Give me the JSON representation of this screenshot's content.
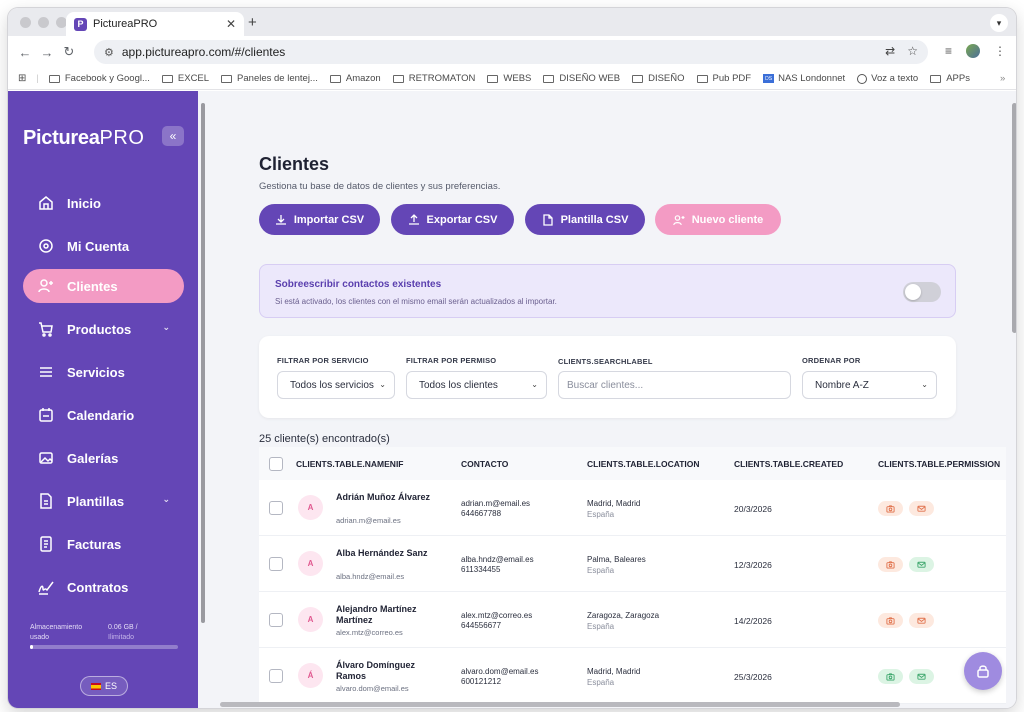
{
  "browser": {
    "tab_title": "PictureaPRO",
    "favicon_letter": "P",
    "url": "app.pictureapro.com/#/clientes",
    "bookmarks": [
      "Facebook y Googl...",
      "EXCEL",
      "Paneles de lentej...",
      "Amazon",
      "RETROMATON",
      "WEBS",
      "DISEÑO WEB",
      "DISEÑO",
      "Pub PDF",
      "NAS Londonnet",
      "Voz a texto",
      "APPs"
    ],
    "bookmarks_overflow": "»"
  },
  "sidebar": {
    "logo_bold": "Picturea",
    "logo_light": "PRO",
    "collapse": "«",
    "items": [
      {
        "label": "Inicio"
      },
      {
        "label": "Mi Cuenta"
      },
      {
        "label": "Clientes",
        "active": true
      },
      {
        "label": "Productos"
      },
      {
        "label": "Servicios"
      },
      {
        "label": "Calendario"
      },
      {
        "label": "Galerías"
      },
      {
        "label": "Plantillas"
      },
      {
        "label": "Facturas"
      },
      {
        "label": "Contratos"
      }
    ],
    "storage_label": "Almacenamiento usado",
    "storage_used": "0.06 GB /",
    "storage_limit": "Ilimitado",
    "language": "ES"
  },
  "main": {
    "title": "Clientes",
    "subtitle": "Gestiona tu base de datos de clientes y sus preferencias.",
    "buttons": {
      "import": "Importar CSV",
      "export": "Exportar CSV",
      "template": "Plantilla CSV",
      "new": "Nuevo cliente"
    },
    "overwrite": {
      "title": "Sobreescribir contactos existentes",
      "description": "Si está activado, los clientes con el mismo email serán actualizados al importar.",
      "enabled": false
    },
    "filters": {
      "service_label": "FILTRAR POR SERVICIO",
      "service_value": "Todos los servicios",
      "permission_label": "FILTRAR POR PERMISO",
      "permission_value": "Todos los clientes",
      "search_label": "CLIENTS.SEARCHLABEL",
      "search_placeholder": "Buscar clientes...",
      "sort_label": "ORDENAR POR",
      "sort_value": "Nombre A-Z"
    },
    "count": "25 cliente(s) encontrado(s)",
    "table": {
      "headers": [
        "CLIENTS.TABLE.NAMENIF",
        "CONTACTO",
        "CLIENTS.TABLE.LOCATION",
        "CLIENTS.TABLE.CREATED",
        "CLIENTS.TABLE.PERMISSION"
      ],
      "rows": [
        {
          "initial": "A",
          "name": "Adrián Muñoz Álvarez",
          "email": "adrian.m@email.es",
          "contact_email": "adrian.m@email.es",
          "phone": "644667788",
          "city": "Madrid, Madrid",
          "country": "España",
          "created": "20/3/2026",
          "photo_permission": false,
          "email_permission": false
        },
        {
          "initial": "A",
          "name": "Alba Hernández Sanz",
          "email": "alba.hndz@email.es",
          "contact_email": "alba.hndz@email.es",
          "phone": "611334455",
          "city": "Palma, Baleares",
          "country": "España",
          "created": "12/3/2026",
          "photo_permission": false,
          "email_permission": true
        },
        {
          "initial": "A",
          "name": "Alejandro Martínez Martínez",
          "email": "alex.mtz@correo.es",
          "contact_email": "alex.mtz@correo.es",
          "phone": "644556677",
          "city": "Zaragoza, Zaragoza",
          "country": "España",
          "created": "14/2/2026",
          "photo_permission": false,
          "email_permission": false
        },
        {
          "initial": "Á",
          "name": "Álvaro Domínguez Ramos",
          "email": "alvaro.dom@email.es",
          "contact_email": "alvaro.dom@email.es",
          "phone": "600121212",
          "city": "Madrid, Madrid",
          "country": "España",
          "created": "25/3/2026",
          "photo_permission": true,
          "email_permission": true
        }
      ]
    }
  },
  "colors": {
    "brand": "#6446b6",
    "accent_pink": "#f39bc4",
    "permission_off": "#fde9df",
    "permission_on": "#dcf4e4"
  }
}
